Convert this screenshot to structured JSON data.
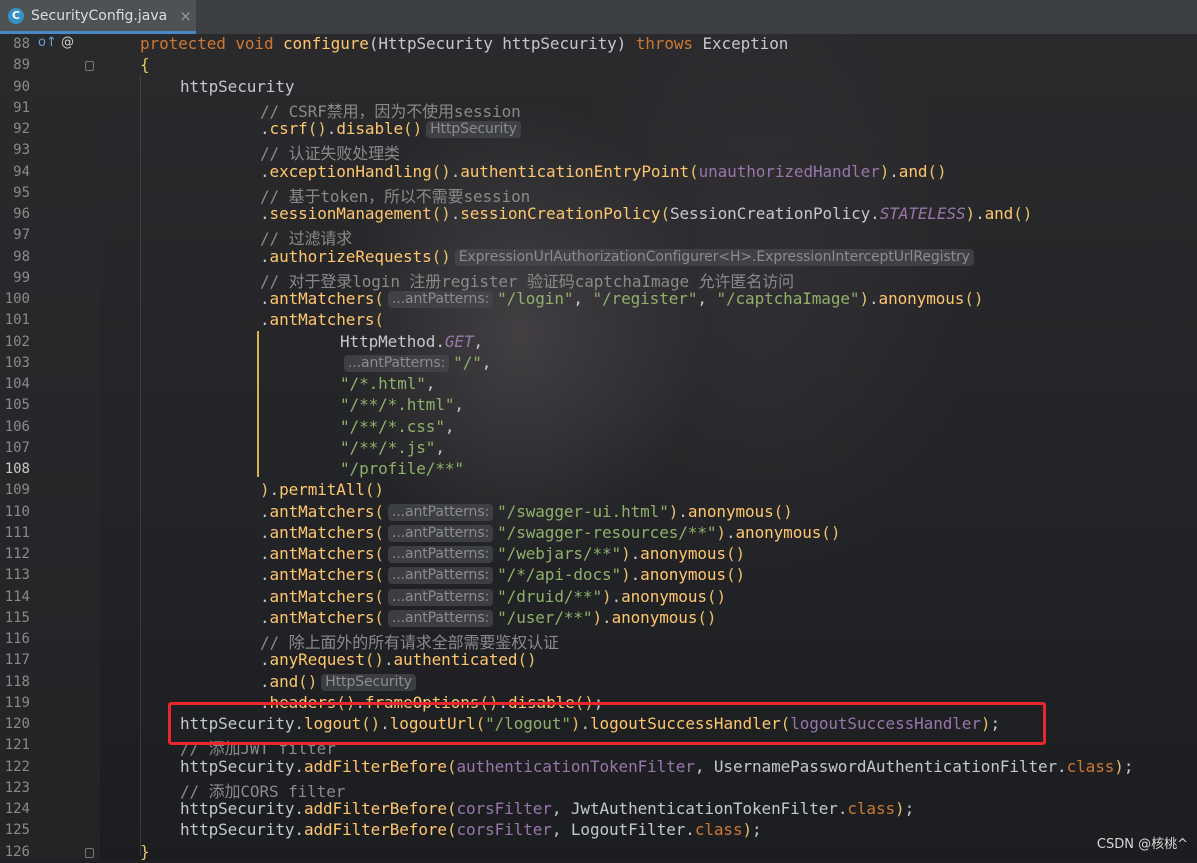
{
  "tab": {
    "icon": "C",
    "icon_name": "java-class-icon",
    "title": "SecurityConfig.java"
  },
  "gutter_markers": {
    "line88": [
      "override-method-icon",
      "annotation-icon"
    ],
    "override_glyph": "o↑",
    "at_glyph": "@"
  },
  "current_line": 108,
  "highlighted_line": 120,
  "watermark": "CSDN @核桃^",
  "lines": [
    {
      "n": 88,
      "indent": 0,
      "tokens": [
        [
          "kw",
          "protected "
        ],
        [
          "kw",
          "void "
        ],
        [
          "fn",
          "configure"
        ],
        [
          "p",
          "(HttpSecurity httpSecurity) "
        ],
        [
          "kw",
          "throws "
        ],
        [
          "p",
          "Exception"
        ]
      ]
    },
    {
      "n": 89,
      "indent": 0,
      "tokens": [
        [
          "par",
          "{"
        ]
      ]
    },
    {
      "n": 90,
      "indent": 4,
      "tokens": [
        [
          "p",
          "httpSecurity"
        ]
      ]
    },
    {
      "n": 91,
      "indent": 12,
      "tokens": [
        [
          "cm",
          "// CSRF禁用，因为不使用session"
        ]
      ]
    },
    {
      "n": 92,
      "indent": 12,
      "tokens": [
        [
          "p",
          "."
        ],
        [
          "fn",
          "csrf"
        ],
        [
          "par",
          "()"
        ],
        [
          "p",
          "."
        ],
        [
          "fn",
          "disable"
        ],
        [
          "par",
          "()"
        ],
        [
          "hint",
          "HttpSecurity"
        ]
      ]
    },
    {
      "n": 93,
      "indent": 12,
      "tokens": [
        [
          "cm",
          "// 认证失败处理类"
        ]
      ]
    },
    {
      "n": 94,
      "indent": 12,
      "tokens": [
        [
          "p",
          "."
        ],
        [
          "fn",
          "exceptionHandling"
        ],
        [
          "par",
          "()"
        ],
        [
          "p",
          "."
        ],
        [
          "fn",
          "authenticationEntryPoint"
        ],
        [
          "par",
          "("
        ],
        [
          "fld",
          "unauthorizedHandler"
        ],
        [
          "par",
          ")"
        ],
        [
          "p",
          "."
        ],
        [
          "fn",
          "and"
        ],
        [
          "par",
          "()"
        ]
      ]
    },
    {
      "n": 95,
      "indent": 12,
      "tokens": [
        [
          "cm",
          "// 基于token，所以不需要session"
        ]
      ]
    },
    {
      "n": 96,
      "indent": 12,
      "tokens": [
        [
          "p",
          "."
        ],
        [
          "fn",
          "sessionManagement"
        ],
        [
          "par",
          "()"
        ],
        [
          "p",
          "."
        ],
        [
          "fn",
          "sessionCreationPolicy"
        ],
        [
          "par",
          "("
        ],
        [
          "p",
          "SessionCreationPolicy."
        ],
        [
          "fldi",
          "STATELESS"
        ],
        [
          "par",
          ")"
        ],
        [
          "p",
          "."
        ],
        [
          "fn",
          "and"
        ],
        [
          "par",
          "()"
        ]
      ]
    },
    {
      "n": 97,
      "indent": 12,
      "tokens": [
        [
          "cm",
          "// 过滤请求"
        ]
      ]
    },
    {
      "n": 98,
      "indent": 12,
      "tokens": [
        [
          "p",
          "."
        ],
        [
          "fn",
          "authorizeRequests"
        ],
        [
          "par",
          "()"
        ],
        [
          "hint",
          "ExpressionUrlAuthorizationConfigurer<H>.ExpressionInterceptUrlRegistry"
        ]
      ]
    },
    {
      "n": 99,
      "indent": 12,
      "tokens": [
        [
          "cm",
          "// 对于登录login 注册register 验证码captchaImage 允许匿名访问"
        ]
      ]
    },
    {
      "n": 100,
      "indent": 12,
      "tokens": [
        [
          "p",
          "."
        ],
        [
          "fn",
          "antMatchers"
        ],
        [
          "par",
          "("
        ],
        [
          "hint",
          "...antPatterns:"
        ],
        [
          "str2",
          "\"/login\""
        ],
        [
          "p",
          ", "
        ],
        [
          "str2",
          "\"/register\""
        ],
        [
          "p",
          ", "
        ],
        [
          "str2",
          "\"/captchaImage\""
        ],
        [
          "par",
          ")"
        ],
        [
          "p",
          "."
        ],
        [
          "fn",
          "anonymous"
        ],
        [
          "par",
          "()"
        ]
      ]
    },
    {
      "n": 101,
      "indent": 12,
      "tokens": [
        [
          "p",
          "."
        ],
        [
          "fn",
          "antMatchers"
        ],
        [
          "par",
          "("
        ]
      ]
    },
    {
      "n": 102,
      "indent": 20,
      "tokens": [
        [
          "p",
          "HttpMethod."
        ],
        [
          "fldi",
          "GET"
        ],
        [
          "p",
          ","
        ]
      ]
    },
    {
      "n": 103,
      "indent": 20,
      "tokens": [
        [
          "hint",
          "...antPatterns:"
        ],
        [
          "str2",
          "\"/\""
        ],
        [
          "p",
          ","
        ]
      ]
    },
    {
      "n": 104,
      "indent": 20,
      "tokens": [
        [
          "str2",
          "\"/*.html\""
        ],
        [
          "p",
          ","
        ]
      ]
    },
    {
      "n": 105,
      "indent": 20,
      "tokens": [
        [
          "str2",
          "\"/**/*.html\""
        ],
        [
          "p",
          ","
        ]
      ]
    },
    {
      "n": 106,
      "indent": 20,
      "tokens": [
        [
          "str2",
          "\"/**/*.css\""
        ],
        [
          "p",
          ","
        ]
      ]
    },
    {
      "n": 107,
      "indent": 20,
      "tokens": [
        [
          "str2",
          "\"/**/*.js\""
        ],
        [
          "p",
          ","
        ]
      ]
    },
    {
      "n": 108,
      "indent": 20,
      "tokens": [
        [
          "str2",
          "\"/profile/**\""
        ]
      ]
    },
    {
      "n": 109,
      "indent": 12,
      "tokens": [
        [
          "par",
          ")"
        ],
        [
          "p",
          "."
        ],
        [
          "fn",
          "permitAll"
        ],
        [
          "par",
          "()"
        ]
      ]
    },
    {
      "n": 110,
      "indent": 12,
      "tokens": [
        [
          "p",
          "."
        ],
        [
          "fn",
          "antMatchers"
        ],
        [
          "par",
          "("
        ],
        [
          "hint",
          "...antPatterns:"
        ],
        [
          "str2",
          "\"/swagger-ui.html\""
        ],
        [
          "par",
          ")"
        ],
        [
          "p",
          "."
        ],
        [
          "fn",
          "anonymous"
        ],
        [
          "par",
          "()"
        ]
      ]
    },
    {
      "n": 111,
      "indent": 12,
      "tokens": [
        [
          "p",
          "."
        ],
        [
          "fn",
          "antMatchers"
        ],
        [
          "par",
          "("
        ],
        [
          "hint",
          "...antPatterns:"
        ],
        [
          "str2",
          "\"/swagger-resources/**\""
        ],
        [
          "par",
          ")"
        ],
        [
          "p",
          "."
        ],
        [
          "fn",
          "anonymous"
        ],
        [
          "par",
          "()"
        ]
      ]
    },
    {
      "n": 112,
      "indent": 12,
      "tokens": [
        [
          "p",
          "."
        ],
        [
          "fn",
          "antMatchers"
        ],
        [
          "par",
          "("
        ],
        [
          "hint",
          "...antPatterns:"
        ],
        [
          "str2",
          "\"/webjars/**\""
        ],
        [
          "par",
          ")"
        ],
        [
          "p",
          "."
        ],
        [
          "fn",
          "anonymous"
        ],
        [
          "par",
          "()"
        ]
      ]
    },
    {
      "n": 113,
      "indent": 12,
      "tokens": [
        [
          "p",
          "."
        ],
        [
          "fn",
          "antMatchers"
        ],
        [
          "par",
          "("
        ],
        [
          "hint",
          "...antPatterns:"
        ],
        [
          "str2",
          "\"/*/api-docs\""
        ],
        [
          "par",
          ")"
        ],
        [
          "p",
          "."
        ],
        [
          "fn",
          "anonymous"
        ],
        [
          "par",
          "()"
        ]
      ]
    },
    {
      "n": 114,
      "indent": 12,
      "tokens": [
        [
          "p",
          "."
        ],
        [
          "fn",
          "antMatchers"
        ],
        [
          "par",
          "("
        ],
        [
          "hint",
          "...antPatterns:"
        ],
        [
          "str2",
          "\"/druid/**\""
        ],
        [
          "par",
          ")"
        ],
        [
          "p",
          "."
        ],
        [
          "fn",
          "anonymous"
        ],
        [
          "par",
          "()"
        ]
      ]
    },
    {
      "n": 115,
      "indent": 12,
      "tokens": [
        [
          "p",
          "."
        ],
        [
          "fn",
          "antMatchers"
        ],
        [
          "par",
          "("
        ],
        [
          "hint",
          "...antPatterns:"
        ],
        [
          "str2",
          "\"/user/**\""
        ],
        [
          "par",
          ")"
        ],
        [
          "p",
          "."
        ],
        [
          "fn",
          "anonymous"
        ],
        [
          "par",
          "()"
        ]
      ]
    },
    {
      "n": 116,
      "indent": 12,
      "tokens": [
        [
          "cm",
          "// 除上面外的所有请求全部需要鉴权认证"
        ]
      ]
    },
    {
      "n": 117,
      "indent": 12,
      "tokens": [
        [
          "p",
          "."
        ],
        [
          "fn",
          "anyRequest"
        ],
        [
          "par",
          "()"
        ],
        [
          "p",
          "."
        ],
        [
          "fn",
          "authenticated"
        ],
        [
          "par",
          "()"
        ]
      ]
    },
    {
      "n": 118,
      "indent": 12,
      "tokens": [
        [
          "p",
          "."
        ],
        [
          "fn",
          "and"
        ],
        [
          "par",
          "()"
        ],
        [
          "hint",
          "HttpSecurity"
        ]
      ]
    },
    {
      "n": 119,
      "indent": 12,
      "tokens": [
        [
          "p",
          "."
        ],
        [
          "fn",
          "headers"
        ],
        [
          "par",
          "()"
        ],
        [
          "p",
          "."
        ],
        [
          "fn",
          "frameOptions"
        ],
        [
          "par",
          "()"
        ],
        [
          "p",
          "."
        ],
        [
          "fn",
          "disable"
        ],
        [
          "par",
          "()"
        ],
        [
          "p",
          ";"
        ]
      ]
    },
    {
      "n": 120,
      "indent": 4,
      "tokens": [
        [
          "p",
          "httpSecurity."
        ],
        [
          "fn",
          "logout"
        ],
        [
          "par",
          "()"
        ],
        [
          "p",
          "."
        ],
        [
          "fn",
          "logoutUrl"
        ],
        [
          "par",
          "("
        ],
        [
          "str2",
          "\"/logout\""
        ],
        [
          "par",
          ")"
        ],
        [
          "p",
          "."
        ],
        [
          "fn",
          "logoutSuccessHandler"
        ],
        [
          "par",
          "("
        ],
        [
          "fld",
          "logoutSuccessHandler"
        ],
        [
          "par",
          ")"
        ],
        [
          "p",
          ";"
        ]
      ]
    },
    {
      "n": 121,
      "indent": 4,
      "tokens": [
        [
          "cm",
          "// 添加JWT filter"
        ]
      ]
    },
    {
      "n": 122,
      "indent": 4,
      "tokens": [
        [
          "p",
          "httpSecurity."
        ],
        [
          "fn",
          "addFilterBefore"
        ],
        [
          "par",
          "("
        ],
        [
          "fld",
          "authenticationTokenFilter"
        ],
        [
          "p",
          ", UsernamePasswordAuthenticationFilter."
        ],
        [
          "kw",
          "class"
        ],
        [
          "par",
          ")"
        ],
        [
          "p",
          ";"
        ]
      ]
    },
    {
      "n": 123,
      "indent": 4,
      "tokens": [
        [
          "cm",
          "// 添加CORS filter"
        ]
      ]
    },
    {
      "n": 124,
      "indent": 4,
      "tokens": [
        [
          "p",
          "httpSecurity."
        ],
        [
          "fn",
          "addFilterBefore"
        ],
        [
          "par",
          "("
        ],
        [
          "fld",
          "corsFilter"
        ],
        [
          "p",
          ", JwtAuthenticationTokenFilter."
        ],
        [
          "kw",
          "class"
        ],
        [
          "par",
          ")"
        ],
        [
          "p",
          ";"
        ]
      ]
    },
    {
      "n": 125,
      "indent": 4,
      "tokens": [
        [
          "p",
          "httpSecurity."
        ],
        [
          "fn",
          "addFilterBefore"
        ],
        [
          "par",
          "("
        ],
        [
          "fld",
          "corsFilter"
        ],
        [
          "p",
          ", LogoutFilter."
        ],
        [
          "kw",
          "class"
        ],
        [
          "par",
          ")"
        ],
        [
          "p",
          ";"
        ]
      ]
    },
    {
      "n": 126,
      "indent": 0,
      "tokens": [
        [
          "par",
          "}"
        ]
      ]
    }
  ]
}
